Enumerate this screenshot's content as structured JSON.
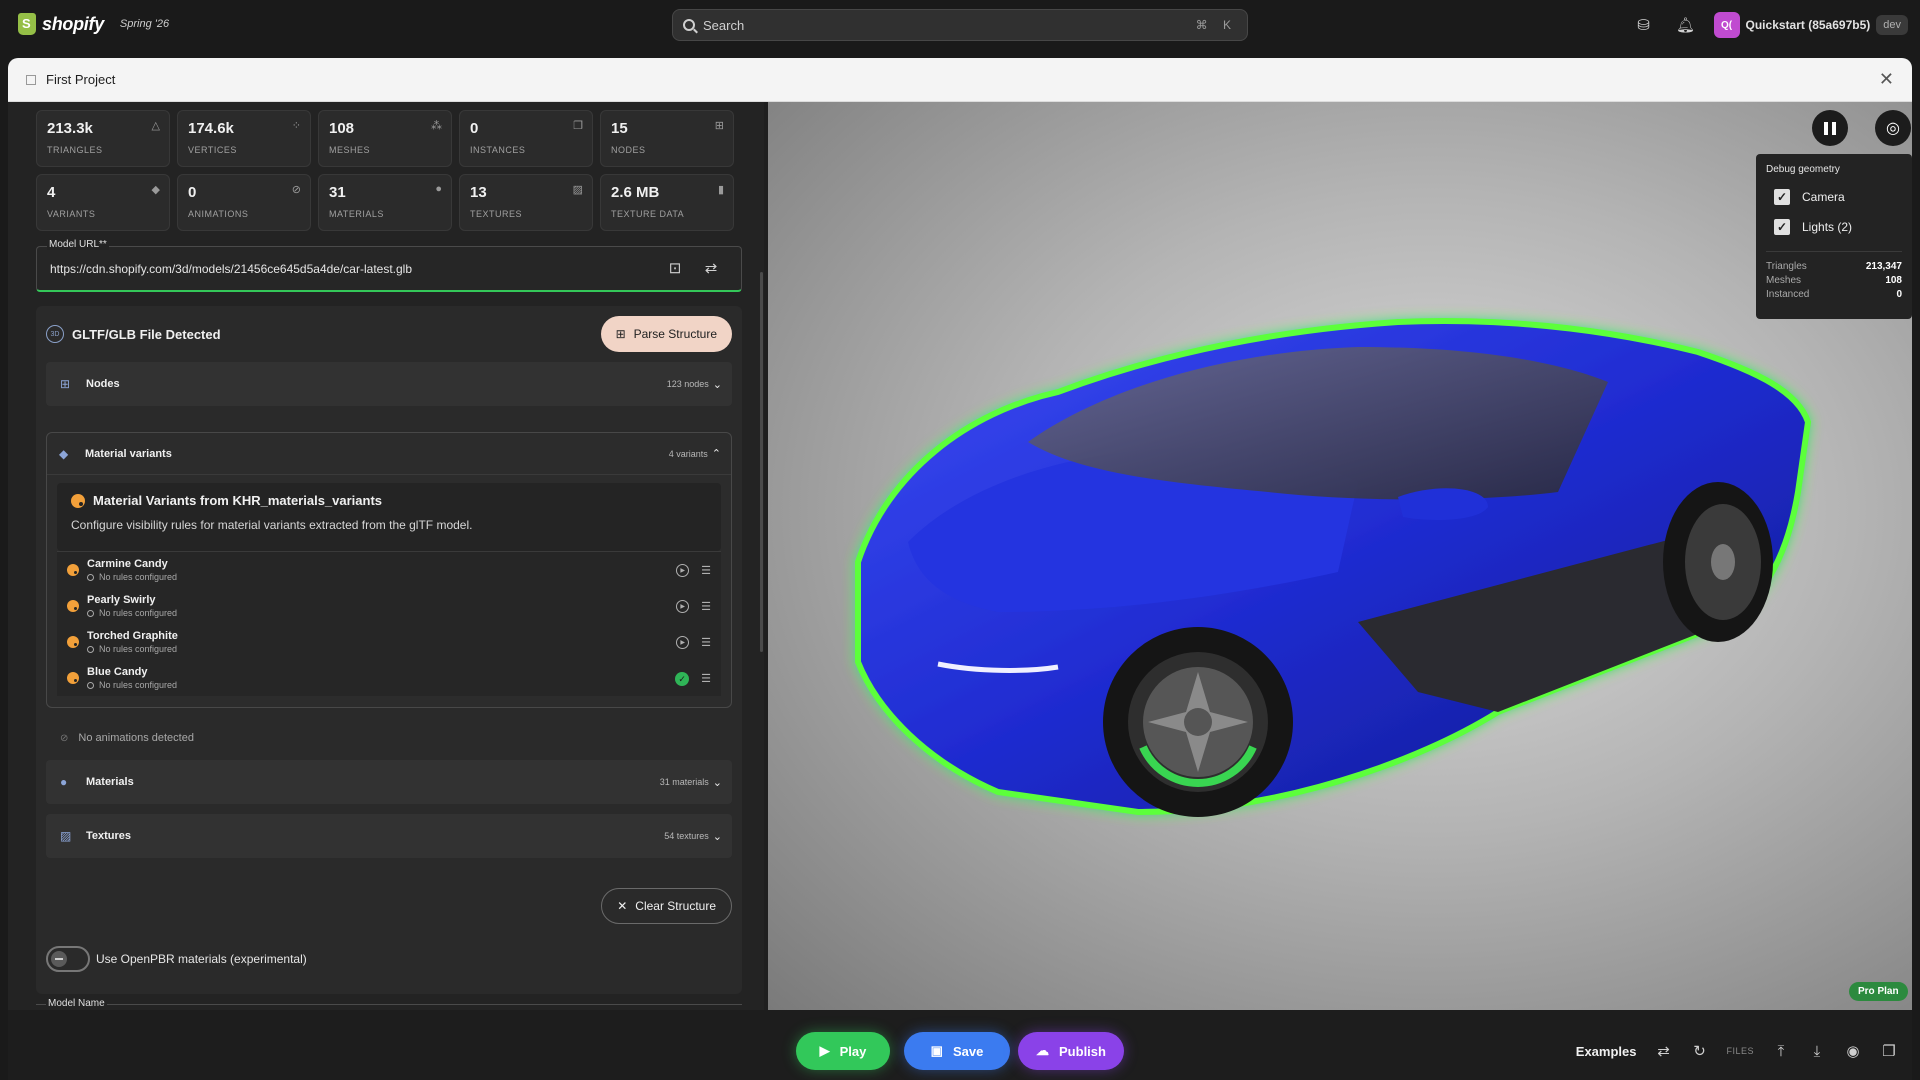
{
  "topbar": {
    "brand": "shopify",
    "season": "Spring '26",
    "search_placeholder": "Search",
    "shortcut": "⌘ K",
    "store_initials": "Q(",
    "store_name": "Quickstart (85a697b5)",
    "store_badge": "dev"
  },
  "window": {
    "title": "First Project"
  },
  "stats": [
    {
      "value": "213.3k",
      "label": "TRIANGLES",
      "icon": "triangle-icon"
    },
    {
      "value": "174.6k",
      "label": "VERTICES",
      "icon": "vertices-icon"
    },
    {
      "value": "108",
      "label": "MESHES",
      "icon": "meshes-icon"
    },
    {
      "value": "0",
      "label": "INSTANCES",
      "icon": "copy-icon"
    },
    {
      "value": "15",
      "label": "NODES",
      "icon": "nodes-icon"
    },
    {
      "value": "4",
      "label": "VARIANTS",
      "icon": "variants-icon"
    },
    {
      "value": "0",
      "label": "ANIMATIONS",
      "icon": "animation-icon"
    },
    {
      "value": "31",
      "label": "MATERIALS",
      "icon": "palette-icon"
    },
    {
      "value": "13",
      "label": "TEXTURES",
      "icon": "texture-icon"
    },
    {
      "value": "2.6 MB",
      "label": "TEXTURE DATA",
      "icon": "storage-icon"
    }
  ],
  "model_url": {
    "label": "Model URL**",
    "value": "https://cdn.shopify.com/3d/models/21456ce645d5a4de/car-latest.glb"
  },
  "gltf": {
    "title": "GLTF/GLB File Detected",
    "parse_label": "Parse Structure",
    "nodes": {
      "title": "Nodes",
      "count": "123 nodes"
    },
    "variants": {
      "title": "Material variants",
      "count": "4 variants",
      "panel_title": "Material Variants from KHR_materials_variants",
      "panel_desc": "Configure visibility rules for material variants extracted from the glTF model.",
      "items": [
        {
          "name": "Carmine Candy",
          "status": "No rules configured"
        },
        {
          "name": "Pearly Swirly",
          "status": "No rules configured"
        },
        {
          "name": "Torched Graphite",
          "status": "No rules configured"
        },
        {
          "name": "Blue Candy",
          "status": "No rules configured"
        }
      ]
    },
    "no_animations": "No animations detected",
    "materials": {
      "title": "Materials",
      "count": "31 materials"
    },
    "textures": {
      "title": "Textures",
      "count": "54 textures"
    },
    "clear_label": "Clear Structure",
    "openpbr_label": "Use OpenPBR materials (experimental)",
    "model_name_label": "Model Name"
  },
  "viewer": {
    "debug_title": "Debug geometry",
    "camera_label": "Camera",
    "lights_label": "Lights (2)",
    "stats": [
      {
        "label": "Triangles",
        "value": "213,347"
      },
      {
        "label": "Meshes",
        "value": "108"
      },
      {
        "label": "Instanced",
        "value": "0"
      }
    ],
    "plan_badge": "Pro Plan",
    "colors": {
      "car_body": "#1f2fd8",
      "outline_glow": "#4cff3a",
      "background": "#c8c8c8"
    }
  },
  "bottom": {
    "play": "Play",
    "save": "Save",
    "publish": "Publish",
    "examples": "Examples",
    "files": "FILES"
  }
}
